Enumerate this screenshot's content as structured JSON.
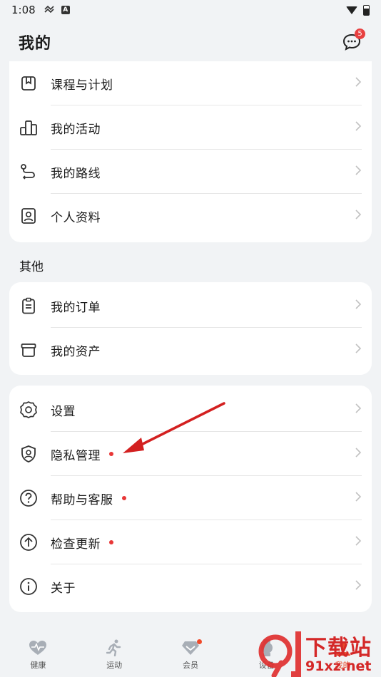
{
  "status_bar": {
    "time": "1:08"
  },
  "header": {
    "title": "我的",
    "message_badge": "5"
  },
  "group1": [
    {
      "label": "课程与计划",
      "icon": "bookmark-icon"
    },
    {
      "label": "我的活动",
      "icon": "activity-blocks-icon"
    },
    {
      "label": "我的路线",
      "icon": "route-icon"
    },
    {
      "label": "个人资料",
      "icon": "profile-card-icon"
    }
  ],
  "other_section_title": "其他",
  "group2": [
    {
      "label": "我的订单",
      "icon": "clipboard-icon"
    },
    {
      "label": "我的资产",
      "icon": "box-icon"
    }
  ],
  "group3": [
    {
      "label": "设置",
      "icon": "gear-icon",
      "dot": false
    },
    {
      "label": "隐私管理",
      "icon": "shield-user-icon",
      "dot": true
    },
    {
      "label": "帮助与客服",
      "icon": "help-circle-icon",
      "dot": true
    },
    {
      "label": "检查更新",
      "icon": "arrow-up-circle-icon",
      "dot": true
    },
    {
      "label": "关于",
      "icon": "info-circle-icon",
      "dot": false
    }
  ],
  "tabbar": [
    {
      "label": "健康",
      "icon": "heart-pulse-icon"
    },
    {
      "label": "运动",
      "icon": "runner-icon"
    },
    {
      "label": "会员",
      "icon": "diamond-icon",
      "dot": true
    },
    {
      "label": "设备",
      "icon": "watch-icon"
    },
    {
      "label": "我的",
      "icon": "user-icon"
    }
  ],
  "watermark": {
    "text_top": "下载站",
    "text_bottom": "91xz.net",
    "logo": "91"
  },
  "colors": {
    "background": "#f1f3f5",
    "card": "#ffffff",
    "accent_red": "#e83737",
    "annotation_arrow": "#d32020"
  }
}
